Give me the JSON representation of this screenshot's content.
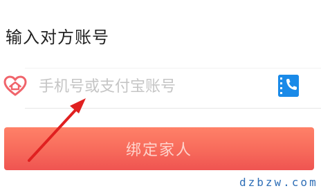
{
  "page": {
    "title": "输入对方账号"
  },
  "account_input": {
    "placeholder": "手机号或支付宝账号",
    "value": ""
  },
  "icons": {
    "left": "heart-home-icon",
    "right": "contacts-book-icon",
    "annotation": "red-arrow"
  },
  "bind_button": {
    "label": "绑定家人"
  },
  "watermark": {
    "text": "dzbzw.com"
  },
  "colors": {
    "heart_icon": "#f0646b",
    "contacts_icon": "#1a8ae8",
    "button_gradient_top": "#ff8168",
    "button_gradient_bottom": "#ef5451",
    "arrow": "#e02020",
    "watermark": "#2f6fb7"
  }
}
